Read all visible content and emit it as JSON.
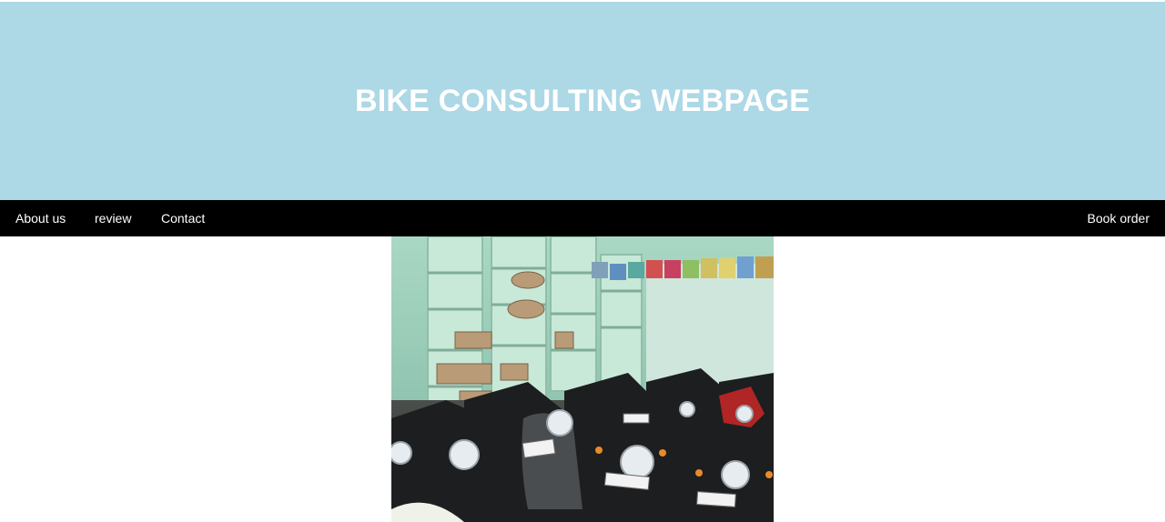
{
  "header": {
    "title": "BIKE CONSULTING WEBPAGE"
  },
  "nav": {
    "items": [
      {
        "label": "About us"
      },
      {
        "label": "review"
      },
      {
        "label": "Contact"
      }
    ],
    "right_item": {
      "label": "Book order"
    }
  },
  "colors": {
    "header_bg": "#add8e6",
    "nav_bg": "#000000",
    "text": "#ffffff"
  },
  "image": {
    "subject": "bike-showroom-photo"
  }
}
